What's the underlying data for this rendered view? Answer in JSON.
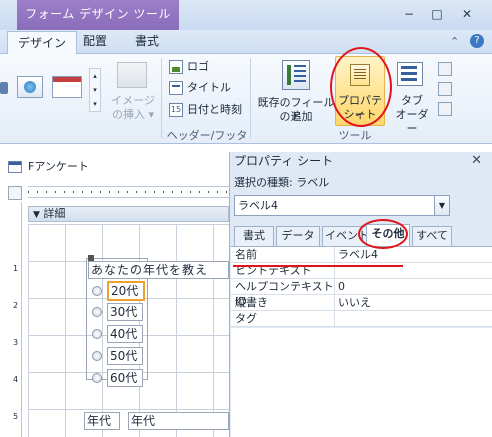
{
  "window": {
    "context_tab": "フォーム デザイン ツール",
    "controls": {
      "minimize": "−",
      "restore": "□",
      "close": "✕"
    }
  },
  "ribbon": {
    "tabs": [
      {
        "label": "デザイン",
        "active": true
      },
      {
        "label": "配置",
        "active": false
      },
      {
        "label": "書式",
        "active": false
      }
    ],
    "help_icon": "help-icon",
    "collapse_icon": "chevron-up-icon",
    "image_insert": {
      "line1": "イメージ",
      "line2": "の挿入",
      "suffix": "▾"
    },
    "header_footer": {
      "logo": "ロゴ",
      "title": "タイトル",
      "datetime": "日付と時刻",
      "group_label": "ヘッダー/フッター"
    },
    "tools": {
      "existing_fields": {
        "line1": "既存のフィールド",
        "line2": "の追加"
      },
      "property_sheet": {
        "line1": "プロパティ",
        "line2": "シート"
      },
      "tab_order": {
        "line1": "タブ",
        "line2": "オーダー"
      },
      "group_label": "ツール"
    }
  },
  "form": {
    "name": "Fアンケート",
    "section": "詳細",
    "question_label": "あなたの年代を教え",
    "options": [
      "20代",
      "30代",
      "40代",
      "50代",
      "60代"
    ],
    "bottom_label": "年代",
    "bottom_field": "年代",
    "ruler_numbers": [
      "1",
      "2",
      "3",
      "4",
      "5"
    ]
  },
  "property_sheet": {
    "title": "プロパティ シート",
    "selection_type": "選択の種類: ラベル",
    "selected_object": "ラベル4",
    "tabs": [
      {
        "label": "書式",
        "active": false
      },
      {
        "label": "データ",
        "active": false
      },
      {
        "label": "イベント",
        "active": false
      },
      {
        "label": "その他",
        "active": true
      },
      {
        "label": "すべて",
        "active": false
      }
    ],
    "rows": [
      {
        "name": "名前",
        "value": "ラベル4"
      },
      {
        "name": "ヒントテキスト",
        "value": ""
      },
      {
        "name": "ヘルプコンテキストID",
        "value": "0"
      },
      {
        "name": "縦書き",
        "value": "いいえ"
      },
      {
        "name": "タグ",
        "value": ""
      }
    ]
  },
  "colors": {
    "annotation_red": "#e1141d",
    "context_tab": "#9c7fc7",
    "selection_orange": "#f0a030"
  }
}
